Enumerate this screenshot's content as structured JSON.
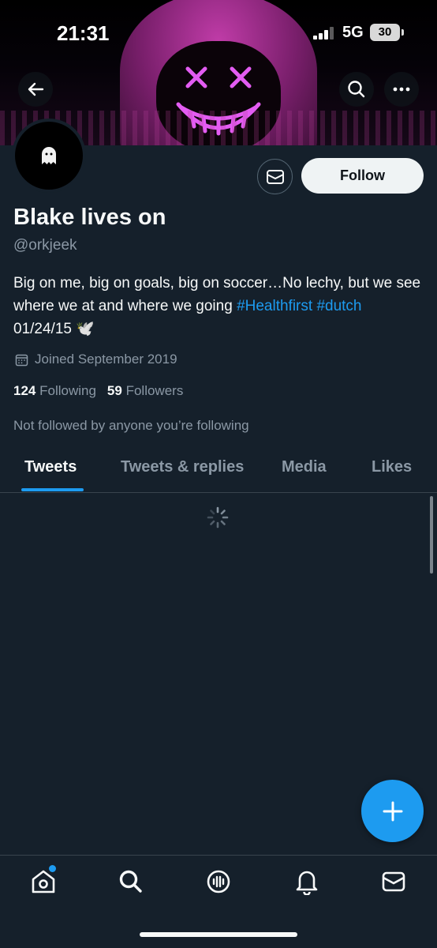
{
  "status_bar": {
    "time": "21:31",
    "network": "5G",
    "battery": "30"
  },
  "profile": {
    "name": "Blake lives on",
    "handle": "@orkjeek",
    "bio": {
      "text": "Big on me, big on goals, big on soccer…No lechy, but we see where we at and where we going ",
      "hashtag1": "#Healthfirst",
      "hashtag2": "#dutch",
      "tail": " 01/24/15 🕊️"
    },
    "joined": "Joined September 2019",
    "following_count": "124",
    "following_label": "Following",
    "followers_count": "59",
    "followers_label": "Followers",
    "not_followed": "Not followed by anyone you’re following"
  },
  "actions": {
    "follow_label": "Follow"
  },
  "tabs": [
    {
      "label": "Tweets",
      "active": true
    },
    {
      "label": "Tweets & replies",
      "active": false
    },
    {
      "label": "Media",
      "active": false
    },
    {
      "label": "Likes",
      "active": false
    }
  ],
  "colors": {
    "background": "#15202b",
    "accent": "#1d9bf0",
    "muted": "#8b98a5"
  },
  "icons": {
    "header": [
      "back-arrow-icon",
      "search-icon",
      "more-icon"
    ],
    "bottom_nav": [
      "home-icon",
      "search-icon",
      "spaces-icon",
      "notifications-icon",
      "messages-icon"
    ]
  }
}
